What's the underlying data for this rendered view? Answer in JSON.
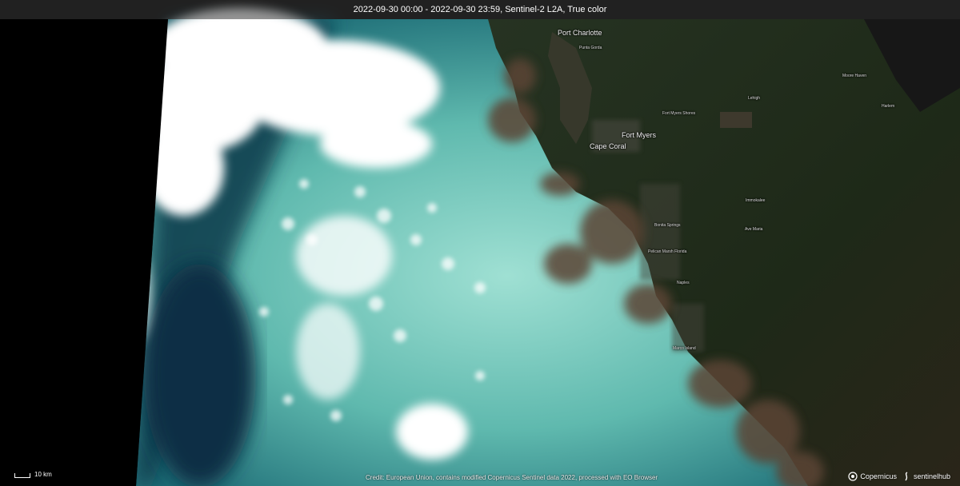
{
  "header": {
    "title": "2022-09-30 00:00 - 2022-09-30 23:59, Sentinel-2 L2A, True color"
  },
  "places": {
    "port_charlotte": "Port Charlotte",
    "punta_gorda": "Punta Gorda",
    "fort_myers": "Fort Myers",
    "fort_myers_shores": "Fort Myers Shores",
    "cape_coral": "Cape Coral",
    "lehigh": "Lehigh",
    "immokalee": "Immokalee",
    "ave_maria": "Ave Maria",
    "bonita_springs": "Bonita Springs",
    "pelican_marsh": "Pelican Marsh Florida",
    "naples": "Naples",
    "moore_haven": "Moore Haven",
    "harlem": "Harlem",
    "marco_island": "Marco Island"
  },
  "scale": {
    "label": "10 km"
  },
  "footer": {
    "credit": "Credit: European Union, contains modified Copernicus Sentinel data 2022, processed with EO Browser",
    "copernicus": "Copernicus",
    "sentinelhub": "sentinelhub"
  },
  "colors": {
    "land": "#1f2a1a",
    "sea_dark": "#0f3b4a",
    "sea_turquoise": "#6fc4b8",
    "sediment": "#5a4636",
    "cloud": "#ffffff"
  }
}
